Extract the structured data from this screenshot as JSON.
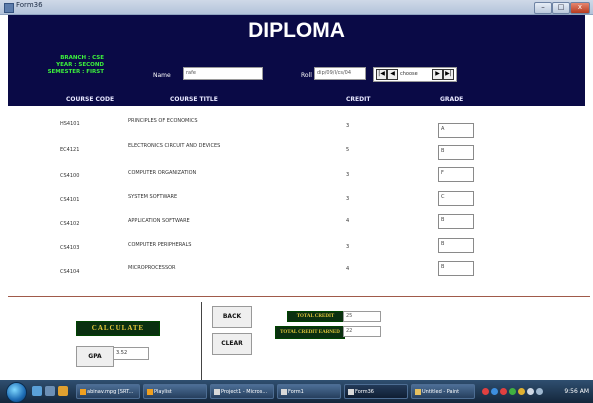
{
  "window": {
    "title": "Form36",
    "min": "–",
    "max": "□",
    "close": "x"
  },
  "header": {
    "title": "DIPLOMA",
    "branch_lines": [
      "BRANCH : CSE",
      "YEAR : SECOND",
      "SEMESTER : FIRST"
    ],
    "name_label": "Name",
    "name_value": "rafe",
    "roll_label": "Roll no",
    "roll_value": "dip/09/I/cs/04",
    "nav": {
      "first": "|◀",
      "prev": "◀",
      "choose": "choose",
      "next": "▶",
      "last": "▶|"
    }
  },
  "columns": {
    "code": "COURSE CODE",
    "title": "COURSE TITLE",
    "credit": "CREDIT",
    "grade": "GRADE"
  },
  "courses": [
    {
      "code": "HS4101",
      "title": "PRINCIPLES OF ECONOMICS",
      "credit": "3",
      "grade": "A"
    },
    {
      "code": "EC4121",
      "title": "ELECTRONICS CIRCUIT AND DEVICES",
      "credit": "5",
      "grade": "B"
    },
    {
      "code": "CS4100",
      "title": "COMPUTER ORGANIZATION",
      "credit": "3",
      "grade": "F"
    },
    {
      "code": "CS4101",
      "title": "SYSTEM SOFTWARE",
      "credit": "3",
      "grade": "C"
    },
    {
      "code": "CS4102",
      "title": "APPLICATION SOFTWARE",
      "credit": "4",
      "grade": "B"
    },
    {
      "code": "CS4103",
      "title": "COMPUTER PERIPHERALS",
      "credit": "3",
      "grade": "B"
    },
    {
      "code": "CS4104",
      "title": "MICROPROCESSOR",
      "credit": "4",
      "grade": "B"
    }
  ],
  "footer": {
    "calculate": "CALCULATE",
    "gpa_label": "GPA",
    "gpa_value": "3.52",
    "back": "BACK",
    "clear": "CLEAR",
    "total_credit_label": "TOTAL CREDIT",
    "total_credit_value": "25",
    "total_earned_label": "TOTAL CREDIT EARNED",
    "total_earned_value": "22"
  },
  "taskbar": {
    "items": [
      {
        "label": "abinav.mpg [SRT..."
      },
      {
        "label": "Playlist"
      },
      {
        "label": "Project1 - Micros..."
      },
      {
        "label": "Form1"
      },
      {
        "label": "Form36"
      },
      {
        "label": "Untitled - Paint"
      }
    ],
    "clock": "9:56 AM"
  },
  "colors": {
    "header_bg": "#0a0a46",
    "branch_text": "#3cf03c",
    "label_gold": "#e6c93b",
    "label_green_bg": "#0a3010"
  }
}
